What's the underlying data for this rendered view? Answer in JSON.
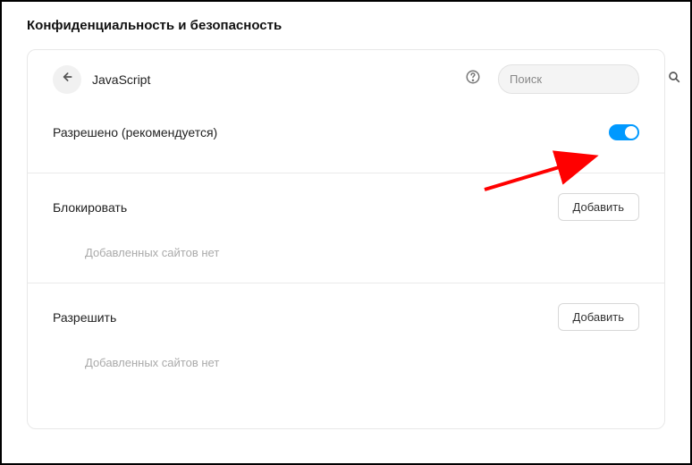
{
  "page": {
    "heading": "Конфиденциальность и безопасность"
  },
  "header": {
    "title": "JavaScript",
    "search_placeholder": "Поиск"
  },
  "toggle": {
    "label": "Разрешено (рекомендуется)",
    "enabled": true
  },
  "sections": {
    "block": {
      "title": "Блокировать",
      "add_label": "Добавить",
      "empty_text": "Добавленных сайтов нет"
    },
    "allow": {
      "title": "Разрешить",
      "add_label": "Добавить",
      "empty_text": "Добавленных сайтов нет"
    }
  }
}
